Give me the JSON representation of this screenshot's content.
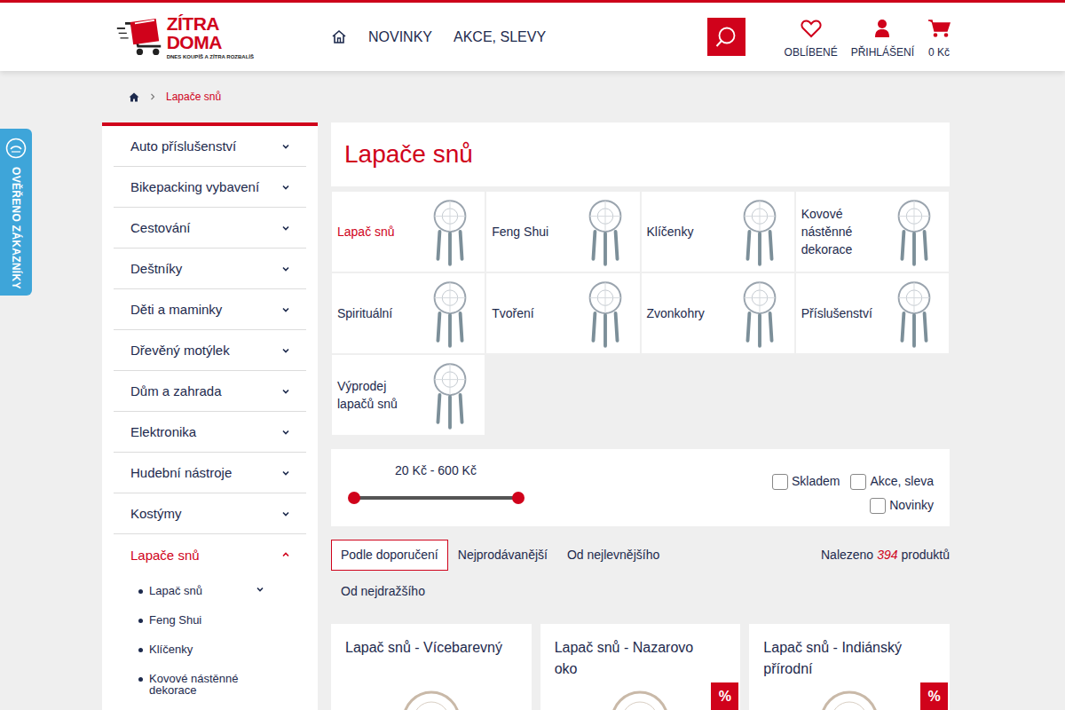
{
  "logo": {
    "title": "ZÍTRA DOMA",
    "tagline": "DNES KOUPÍŠ A ZÍTRA ROZBALÍŠ"
  },
  "nav": [
    {
      "label": "NOVINKY"
    },
    {
      "label": "AKCE, SLEVY"
    }
  ],
  "header_actions": [
    {
      "label": "OBLÍBENÉ"
    },
    {
      "label": "PŘIHLÁŠENÍ"
    },
    {
      "label": "0 Kč"
    }
  ],
  "trust_badge": {
    "label": "OVĚŘENO ZÁKAZNÍKY"
  },
  "breadcrumb": {
    "current": "Lapače snů"
  },
  "sidebar": {
    "items": [
      {
        "label": "Auto příslušenství",
        "expanded": false,
        "selected": false
      },
      {
        "label": "Bikepacking vybavení",
        "expanded": false,
        "selected": false
      },
      {
        "label": "Cestování",
        "expanded": false,
        "selected": false
      },
      {
        "label": "Deštníky",
        "expanded": false,
        "selected": false
      },
      {
        "label": "Děti a maminky",
        "expanded": false,
        "selected": false
      },
      {
        "label": "Dřevěný motýlek",
        "expanded": false,
        "selected": false
      },
      {
        "label": "Dům a zahrada",
        "expanded": false,
        "selected": false
      },
      {
        "label": "Elektronika",
        "expanded": false,
        "selected": false
      },
      {
        "label": "Hudební nástroje",
        "expanded": false,
        "selected": false
      },
      {
        "label": "Kostýmy",
        "expanded": false,
        "selected": false
      },
      {
        "label": "Lapače snů",
        "expanded": true,
        "selected": true
      }
    ],
    "subitems": [
      {
        "label": "Lapač snů",
        "has_children": true
      },
      {
        "label": "Feng Shui",
        "has_children": false
      },
      {
        "label": "Klíčenky",
        "has_children": false
      },
      {
        "label": "Kovové nástěnné dekorace",
        "has_children": false
      }
    ]
  },
  "page_title": "Lapače snů",
  "categories": [
    {
      "label": "Lapač snů",
      "selected": true
    },
    {
      "label": "Feng Shui",
      "selected": false
    },
    {
      "label": "Klíčenky",
      "selected": false
    },
    {
      "label": "Kovové nástěnné dekorace",
      "selected": false
    },
    {
      "label": "Spirituální",
      "selected": false
    },
    {
      "label": "Tvoření",
      "selected": false
    },
    {
      "label": "Zvonkohry",
      "selected": false
    },
    {
      "label": "Příslušenství",
      "selected": false
    },
    {
      "label": "Výprodej lapačů snů",
      "selected": false
    }
  ],
  "filters": {
    "price": {
      "label": "20 Kč - 600 Kč",
      "low": 0,
      "high": 1
    },
    "checkboxes": [
      {
        "label": "Skladem",
        "checked": false
      },
      {
        "label": "Akce, sleva",
        "checked": false
      },
      {
        "label": "Novinky",
        "checked": false
      }
    ]
  },
  "sort": {
    "options": [
      {
        "label": "Podle doporučení",
        "selected": true
      },
      {
        "label": "Nejprodávanější",
        "selected": false
      },
      {
        "label": "Od nejlevnějšího",
        "selected": false
      },
      {
        "label": "Od nejdražšího",
        "selected": false
      }
    ],
    "found": {
      "prefix": "Nalezeno",
      "count": "394",
      "suffix": "produktů"
    }
  },
  "products": [
    {
      "title": "Lapač snů - Vícebarevný",
      "sale": false,
      "badge": "%"
    },
    {
      "title": "Lapač snů - Nazarovo oko",
      "sale": true,
      "badge": "%"
    },
    {
      "title": "Lapač snů - Indiánský přírodní",
      "sale": true,
      "badge": "%"
    }
  ]
}
